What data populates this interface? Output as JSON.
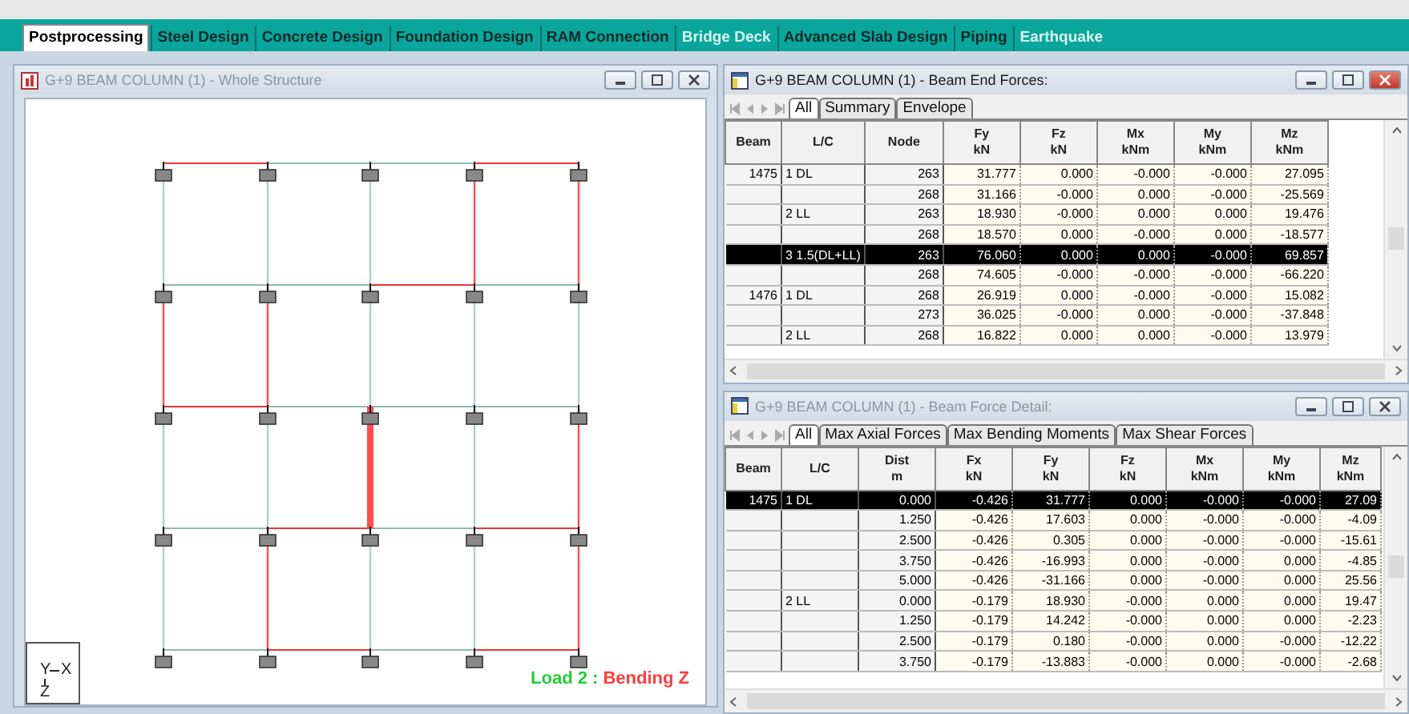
{
  "ribbon": {
    "tabs": [
      {
        "label": "Postprocessing",
        "selected": true,
        "disabled": false
      },
      {
        "label": "Steel Design",
        "selected": false,
        "disabled": false
      },
      {
        "label": "Concrete Design",
        "selected": false,
        "disabled": false
      },
      {
        "label": "Foundation Design",
        "selected": false,
        "disabled": false
      },
      {
        "label": "RAM Connection",
        "selected": false,
        "disabled": false
      },
      {
        "label": "Bridge Deck",
        "selected": false,
        "disabled": true
      },
      {
        "label": "Advanced Slab Design",
        "selected": false,
        "disabled": false
      },
      {
        "label": "Piping",
        "selected": false,
        "disabled": false
      },
      {
        "label": "Earthquake",
        "selected": false,
        "disabled": true
      }
    ]
  },
  "structure_window": {
    "title": "G+9 BEAM COLUMN (1) - Whole Structure",
    "active": false,
    "axis_labels": [
      "Y",
      "X",
      "Z"
    ],
    "load_label": {
      "load": "Load 2 :",
      "result": "Bending Z"
    }
  },
  "end_forces_window": {
    "title": "G+9 BEAM COLUMN (1) - Beam End Forces:",
    "active": true,
    "tabs": [
      {
        "label": "All",
        "selected": true
      },
      {
        "label": "Summary",
        "selected": false
      },
      {
        "label": "Envelope",
        "selected": false
      }
    ],
    "columns": [
      {
        "label": "Beam"
      },
      {
        "label": "L/C"
      },
      {
        "label": "Node"
      },
      {
        "label": "Fy",
        "unit": "kN"
      },
      {
        "label": "Fz",
        "unit": "kN"
      },
      {
        "label": "Mx",
        "unit": "kNm"
      },
      {
        "label": "My",
        "unit": "kNm"
      },
      {
        "label": "Mz",
        "unit": "kNm"
      }
    ],
    "rows": [
      {
        "cells": [
          "1475",
          "1 DL",
          "263",
          "31.777",
          "0.000",
          "-0.000",
          "-0.000",
          "27.095"
        ],
        "selected": false
      },
      {
        "cells": [
          "",
          "",
          "268",
          "31.166",
          "-0.000",
          "0.000",
          "-0.000",
          "-25.569"
        ],
        "selected": false
      },
      {
        "cells": [
          "",
          "2 LL",
          "263",
          "18.930",
          "-0.000",
          "0.000",
          "0.000",
          "19.476"
        ],
        "selected": false
      },
      {
        "cells": [
          "",
          "",
          "268",
          "18.570",
          "0.000",
          "-0.000",
          "0.000",
          "-18.577"
        ],
        "selected": false
      },
      {
        "cells": [
          "",
          "3 1.5(DL+LL)",
          "263",
          "76.060",
          "0.000",
          "0.000",
          "-0.000",
          "69.857"
        ],
        "selected": true
      },
      {
        "cells": [
          "",
          "",
          "268",
          "74.605",
          "-0.000",
          "-0.000",
          "-0.000",
          "-66.220"
        ],
        "selected": false
      },
      {
        "cells": [
          "1476",
          "1 DL",
          "268",
          "26.919",
          "0.000",
          "-0.000",
          "-0.000",
          "15.082"
        ],
        "selected": false
      },
      {
        "cells": [
          "",
          "",
          "273",
          "36.025",
          "-0.000",
          "0.000",
          "-0.000",
          "-37.848"
        ],
        "selected": false
      },
      {
        "cells": [
          "",
          "2 LL",
          "268",
          "16.822",
          "0.000",
          "0.000",
          "-0.000",
          "13.979"
        ],
        "selected": false
      }
    ]
  },
  "force_detail_window": {
    "title": "G+9 BEAM COLUMN (1) - Beam Force Detail:",
    "active": false,
    "tabs": [
      {
        "label": "All",
        "selected": true
      },
      {
        "label": "Max Axial Forces",
        "selected": false
      },
      {
        "label": "Max Bending Moments",
        "selected": false
      },
      {
        "label": "Max Shear Forces",
        "selected": false
      }
    ],
    "columns": [
      {
        "label": "Beam"
      },
      {
        "label": "L/C"
      },
      {
        "label": "Dist",
        "unit": "m"
      },
      {
        "label": "Fx",
        "unit": "kN"
      },
      {
        "label": "Fy",
        "unit": "kN"
      },
      {
        "label": "Fz",
        "unit": "kN"
      },
      {
        "label": "Mx",
        "unit": "kNm"
      },
      {
        "label": "My",
        "unit": "kNm"
      },
      {
        "label": "Mz",
        "unit": "kNm"
      }
    ],
    "rows": [
      {
        "cells": [
          "1475",
          "1 DL",
          "0.000",
          "-0.426",
          "31.777",
          "0.000",
          "-0.000",
          "-0.000",
          "27.09"
        ],
        "selected": true
      },
      {
        "cells": [
          "",
          "",
          "1.250",
          "-0.426",
          "17.603",
          "0.000",
          "-0.000",
          "-0.000",
          "-4.09"
        ],
        "selected": false
      },
      {
        "cells": [
          "",
          "",
          "2.500",
          "-0.426",
          "0.305",
          "0.000",
          "-0.000",
          "-0.000",
          "-15.61"
        ],
        "selected": false
      },
      {
        "cells": [
          "",
          "",
          "3.750",
          "-0.426",
          "-16.993",
          "0.000",
          "-0.000",
          "0.000",
          "-4.85"
        ],
        "selected": false
      },
      {
        "cells": [
          "",
          "",
          "5.000",
          "-0.426",
          "-31.166",
          "0.000",
          "-0.000",
          "0.000",
          "25.56"
        ],
        "selected": false
      },
      {
        "cells": [
          "",
          "2 LL",
          "0.000",
          "-0.179",
          "18.930",
          "-0.000",
          "0.000",
          "0.000",
          "19.47"
        ],
        "selected": false
      },
      {
        "cells": [
          "",
          "",
          "1.250",
          "-0.179",
          "14.242",
          "-0.000",
          "0.000",
          "0.000",
          "-2.23"
        ],
        "selected": false
      },
      {
        "cells": [
          "",
          "",
          "2.500",
          "-0.179",
          "0.180",
          "-0.000",
          "0.000",
          "-0.000",
          "-12.22"
        ],
        "selected": false
      },
      {
        "cells": [
          "",
          "",
          "3.750",
          "-0.179",
          "-13.883",
          "-0.000",
          "0.000",
          "-0.000",
          "-2.68"
        ],
        "selected": false
      }
    ]
  }
}
